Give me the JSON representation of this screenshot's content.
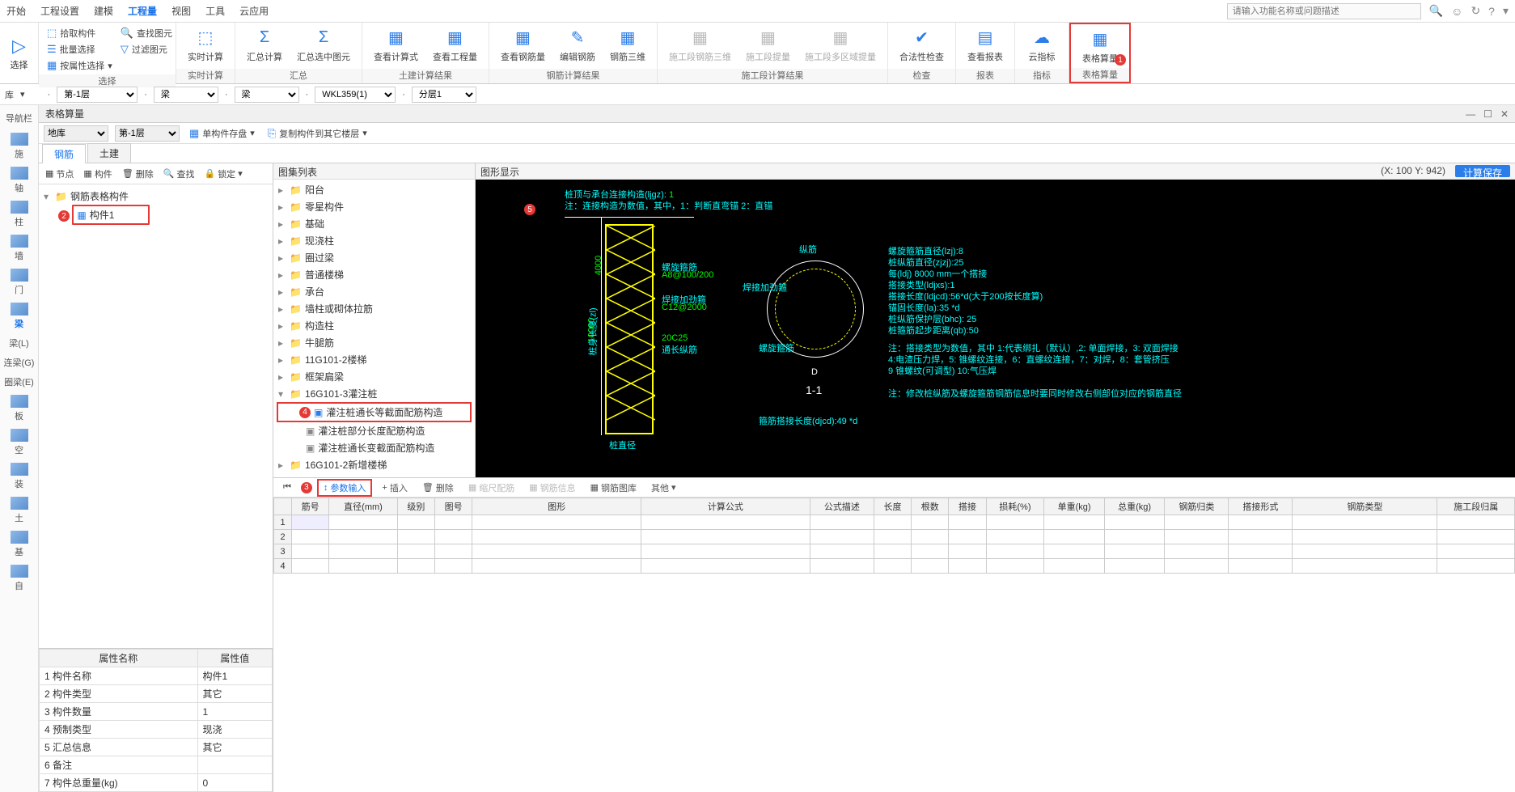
{
  "menubar": {
    "items": [
      "开始",
      "工程设置",
      "建模",
      "工程量",
      "视图",
      "工具",
      "云应用"
    ],
    "active_index": 3,
    "search_placeholder": "请输入功能名称或问题描述"
  },
  "ribbon": {
    "select_arrow": "选择",
    "sel_group": {
      "items": [
        "拾取构件",
        "批量选择",
        "按属性选择"
      ],
      "right": [
        "查找图元",
        "过滤图元"
      ],
      "label": "选择"
    },
    "groups": [
      {
        "label": "实时计算",
        "btns": [
          {
            "lb": "实时计算"
          }
        ]
      },
      {
        "label": "汇总",
        "btns": [
          {
            "lb": "汇总计算"
          },
          {
            "lb": "汇总选中图元"
          }
        ]
      },
      {
        "label": "土建计算结果",
        "btns": [
          {
            "lb": "查看计算式"
          },
          {
            "lb": "查看工程量"
          }
        ]
      },
      {
        "label": "钢筋计算结果",
        "btns": [
          {
            "lb": "查看钢筋量"
          },
          {
            "lb": "编辑钢筋"
          },
          {
            "lb": "钢筋三维"
          }
        ]
      },
      {
        "label": "施工段计算结果",
        "btns": [
          {
            "lb": "施工段钢筋三维",
            "dim": true
          },
          {
            "lb": "施工段提量",
            "dim": true
          },
          {
            "lb": "施工段多区域提量",
            "dim": true
          }
        ]
      },
      {
        "label": "检查",
        "btns": [
          {
            "lb": "合法性检查"
          }
        ]
      },
      {
        "label": "报表",
        "btns": [
          {
            "lb": "查看报表"
          }
        ]
      },
      {
        "label": "指标",
        "btns": [
          {
            "lb": "云指标"
          }
        ]
      },
      {
        "label": "表格算量",
        "btns": [
          {
            "lb": "表格算量"
          }
        ],
        "hl": true,
        "badge": "1"
      }
    ]
  },
  "secbar": {
    "a": "库",
    "b": "第-1层",
    "c": "梁",
    "d": "梁",
    "e": "WKL359(1)",
    "f": "分层1"
  },
  "leftrail": {
    "title": "导航栏",
    "items": [
      "施",
      "轴",
      "柱",
      "墙",
      "门",
      "梁",
      "梁(L)",
      "连梁(G)",
      "圈梁(E)",
      "板",
      "空",
      "装",
      "土",
      "基",
      "自"
    ],
    "active_index": 5
  },
  "workspace": {
    "title": "表格算量",
    "tools": {
      "a": "地库",
      "b": "第-1层",
      "c": "单构件存盘",
      "d": "复制构件到其它楼层"
    },
    "tabs": [
      "钢筋",
      "土建"
    ],
    "active_tab": 0,
    "tree_tools": [
      "节点",
      "构件",
      "删除",
      "查找",
      "锁定"
    ],
    "tree": {
      "root": "钢筋表格构件",
      "child": "构件1",
      "badge": "2"
    },
    "mid": {
      "hdr": "图集列表",
      "items": [
        "阳台",
        "零星构件",
        "基础",
        "现浇柱",
        "圈过梁",
        "普通楼梯",
        "承台",
        "墙柱或砌体拉筋",
        "构造柱",
        "牛腿筋",
        "11G101-2楼梯",
        "框架扁梁"
      ],
      "exp": {
        "label": "16G101-3灌注桩",
        "children": [
          "灌注桩通长等截面配筋构造",
          "灌注桩部分长度配筋构造",
          "灌注桩通长变截面配筋构造"
        ],
        "hl_index": 0,
        "badge": "4"
      },
      "last": "16G101-2新增楼梯"
    },
    "diag": {
      "hdr": "图形显示",
      "coords": "(X: 100 Y: 942)",
      "save": "计算保存",
      "badge": "5",
      "lines": {
        "l1": "桩顶与承台连接构造(ljgz): ",
        "l1v": "1",
        "l2": "注：连接构造为数值，其中，1：判断直弯锚     2：直锚",
        "l3": "螺旋箍筋",
        "l3b": "A8@100/200",
        "l4": "焊接加劲箍",
        "l4b": "C12@2000",
        "l5": "螺旋箍筋",
        "l6": "焊接加劲箍",
        "l7": "纵筋",
        "l8": "20C25",
        "l9": "通长纵筋",
        "l10": "桩直径",
        "l11": "D",
        "l12": "1-1",
        "l13": "箍筋搭接长度(djcd):49 *d",
        "r1": "螺旋箍筋直径(lzj):8",
        "r2": "桩纵筋直径(zjzj):25",
        "r3": "每(ldj) 8000 mm一个搭接",
        "r4": "搭接类型(ldjxs):1",
        "r5": "搭接长度(ldjcd):56*d(大于200按长度算)",
        "r6": "锚固长度(la):35 *d",
        "r7": "桩纵筋保护层(bhc): 25",
        "r8": "桩箍筋起步距离(qb):50",
        "n1": "注：搭接类型为数值，其中 1:代表绑扎（默认）,2: 单面焊接，3: 双面焊接",
        "n2": "    4:电渣压力焊，5: 锥螺纹连接，6：直螺纹连接，7：对焊，8：套管挤压",
        "n3": "    9 锥螺纹(可调型)  10:气压焊",
        "n4": "注：修改桩纵筋及螺旋箍筋钢筋信息时要同时修改右侧部位对应的钢筋直径",
        "lenlabel": "桩身长度(zl)",
        "len": "10000",
        "top": "4000"
      }
    },
    "prop": {
      "hdr": [
        "属性名称",
        "属性值"
      ],
      "rows": [
        [
          "构件名称",
          "构件1"
        ],
        [
          "构件类型",
          "其它"
        ],
        [
          "构件数量",
          "1"
        ],
        [
          "预制类型",
          "现浇"
        ],
        [
          "汇总信息",
          "其它"
        ],
        [
          "备注",
          ""
        ],
        [
          "构件总重量(kg)",
          "0"
        ]
      ]
    },
    "gridtools": [
      "参数输入",
      "插入",
      "删除",
      "缩尺配筋",
      "钢筋信息",
      "钢筋图库",
      "其他"
    ],
    "gridtools_badge": "3",
    "gridcols": [
      "筋号",
      "直径(mm)",
      "级别",
      "图号",
      "图形",
      "计算公式",
      "公式描述",
      "长度",
      "根数",
      "搭接",
      "损耗(%)",
      "单重(kg)",
      "总重(kg)",
      "钢筋归类",
      "搭接形式",
      "钢筋类型",
      "施工段归属"
    ]
  }
}
